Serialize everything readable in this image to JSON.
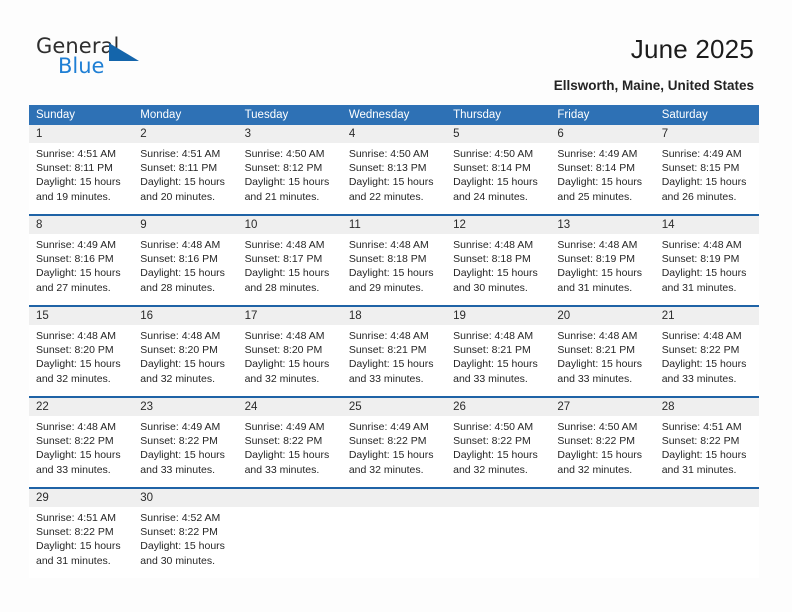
{
  "brand": {
    "name_part1": "General",
    "name_part2": "Blue",
    "accent_color": "#1f7fd4",
    "triangle_color": "#1465ab"
  },
  "header": {
    "title": "June 2025",
    "location": "Ellsworth, Maine, United States"
  },
  "theme": {
    "header_blue": "#2e71b5",
    "row_divider_blue": "#1f63a6",
    "daynum_band": "#efefef"
  },
  "weekdays": [
    "Sunday",
    "Monday",
    "Tuesday",
    "Wednesday",
    "Thursday",
    "Friday",
    "Saturday"
  ],
  "weeks": [
    [
      {
        "day": "1",
        "sunrise": "Sunrise: 4:51 AM",
        "sunset": "Sunset: 8:11 PM",
        "daylight1": "Daylight: 15 hours",
        "daylight2": "and 19 minutes."
      },
      {
        "day": "2",
        "sunrise": "Sunrise: 4:51 AM",
        "sunset": "Sunset: 8:11 PM",
        "daylight1": "Daylight: 15 hours",
        "daylight2": "and 20 minutes."
      },
      {
        "day": "3",
        "sunrise": "Sunrise: 4:50 AM",
        "sunset": "Sunset: 8:12 PM",
        "daylight1": "Daylight: 15 hours",
        "daylight2": "and 21 minutes."
      },
      {
        "day": "4",
        "sunrise": "Sunrise: 4:50 AM",
        "sunset": "Sunset: 8:13 PM",
        "daylight1": "Daylight: 15 hours",
        "daylight2": "and 22 minutes."
      },
      {
        "day": "5",
        "sunrise": "Sunrise: 4:50 AM",
        "sunset": "Sunset: 8:14 PM",
        "daylight1": "Daylight: 15 hours",
        "daylight2": "and 24 minutes."
      },
      {
        "day": "6",
        "sunrise": "Sunrise: 4:49 AM",
        "sunset": "Sunset: 8:14 PM",
        "daylight1": "Daylight: 15 hours",
        "daylight2": "and 25 minutes."
      },
      {
        "day": "7",
        "sunrise": "Sunrise: 4:49 AM",
        "sunset": "Sunset: 8:15 PM",
        "daylight1": "Daylight: 15 hours",
        "daylight2": "and 26 minutes."
      }
    ],
    [
      {
        "day": "8",
        "sunrise": "Sunrise: 4:49 AM",
        "sunset": "Sunset: 8:16 PM",
        "daylight1": "Daylight: 15 hours",
        "daylight2": "and 27 minutes."
      },
      {
        "day": "9",
        "sunrise": "Sunrise: 4:48 AM",
        "sunset": "Sunset: 8:16 PM",
        "daylight1": "Daylight: 15 hours",
        "daylight2": "and 28 minutes."
      },
      {
        "day": "10",
        "sunrise": "Sunrise: 4:48 AM",
        "sunset": "Sunset: 8:17 PM",
        "daylight1": "Daylight: 15 hours",
        "daylight2": "and 28 minutes."
      },
      {
        "day": "11",
        "sunrise": "Sunrise: 4:48 AM",
        "sunset": "Sunset: 8:18 PM",
        "daylight1": "Daylight: 15 hours",
        "daylight2": "and 29 minutes."
      },
      {
        "day": "12",
        "sunrise": "Sunrise: 4:48 AM",
        "sunset": "Sunset: 8:18 PM",
        "daylight1": "Daylight: 15 hours",
        "daylight2": "and 30 minutes."
      },
      {
        "day": "13",
        "sunrise": "Sunrise: 4:48 AM",
        "sunset": "Sunset: 8:19 PM",
        "daylight1": "Daylight: 15 hours",
        "daylight2": "and 31 minutes."
      },
      {
        "day": "14",
        "sunrise": "Sunrise: 4:48 AM",
        "sunset": "Sunset: 8:19 PM",
        "daylight1": "Daylight: 15 hours",
        "daylight2": "and 31 minutes."
      }
    ],
    [
      {
        "day": "15",
        "sunrise": "Sunrise: 4:48 AM",
        "sunset": "Sunset: 8:20 PM",
        "daylight1": "Daylight: 15 hours",
        "daylight2": "and 32 minutes."
      },
      {
        "day": "16",
        "sunrise": "Sunrise: 4:48 AM",
        "sunset": "Sunset: 8:20 PM",
        "daylight1": "Daylight: 15 hours",
        "daylight2": "and 32 minutes."
      },
      {
        "day": "17",
        "sunrise": "Sunrise: 4:48 AM",
        "sunset": "Sunset: 8:20 PM",
        "daylight1": "Daylight: 15 hours",
        "daylight2": "and 32 minutes."
      },
      {
        "day": "18",
        "sunrise": "Sunrise: 4:48 AM",
        "sunset": "Sunset: 8:21 PM",
        "daylight1": "Daylight: 15 hours",
        "daylight2": "and 33 minutes."
      },
      {
        "day": "19",
        "sunrise": "Sunrise: 4:48 AM",
        "sunset": "Sunset: 8:21 PM",
        "daylight1": "Daylight: 15 hours",
        "daylight2": "and 33 minutes."
      },
      {
        "day": "20",
        "sunrise": "Sunrise: 4:48 AM",
        "sunset": "Sunset: 8:21 PM",
        "daylight1": "Daylight: 15 hours",
        "daylight2": "and 33 minutes."
      },
      {
        "day": "21",
        "sunrise": "Sunrise: 4:48 AM",
        "sunset": "Sunset: 8:22 PM",
        "daylight1": "Daylight: 15 hours",
        "daylight2": "and 33 minutes."
      }
    ],
    [
      {
        "day": "22",
        "sunrise": "Sunrise: 4:48 AM",
        "sunset": "Sunset: 8:22 PM",
        "daylight1": "Daylight: 15 hours",
        "daylight2": "and 33 minutes."
      },
      {
        "day": "23",
        "sunrise": "Sunrise: 4:49 AM",
        "sunset": "Sunset: 8:22 PM",
        "daylight1": "Daylight: 15 hours",
        "daylight2": "and 33 minutes."
      },
      {
        "day": "24",
        "sunrise": "Sunrise: 4:49 AM",
        "sunset": "Sunset: 8:22 PM",
        "daylight1": "Daylight: 15 hours",
        "daylight2": "and 33 minutes."
      },
      {
        "day": "25",
        "sunrise": "Sunrise: 4:49 AM",
        "sunset": "Sunset: 8:22 PM",
        "daylight1": "Daylight: 15 hours",
        "daylight2": "and 32 minutes."
      },
      {
        "day": "26",
        "sunrise": "Sunrise: 4:50 AM",
        "sunset": "Sunset: 8:22 PM",
        "daylight1": "Daylight: 15 hours",
        "daylight2": "and 32 minutes."
      },
      {
        "day": "27",
        "sunrise": "Sunrise: 4:50 AM",
        "sunset": "Sunset: 8:22 PM",
        "daylight1": "Daylight: 15 hours",
        "daylight2": "and 32 minutes."
      },
      {
        "day": "28",
        "sunrise": "Sunrise: 4:51 AM",
        "sunset": "Sunset: 8:22 PM",
        "daylight1": "Daylight: 15 hours",
        "daylight2": "and 31 minutes."
      }
    ],
    [
      {
        "day": "29",
        "sunrise": "Sunrise: 4:51 AM",
        "sunset": "Sunset: 8:22 PM",
        "daylight1": "Daylight: 15 hours",
        "daylight2": "and 31 minutes."
      },
      {
        "day": "30",
        "sunrise": "Sunrise: 4:52 AM",
        "sunset": "Sunset: 8:22 PM",
        "daylight1": "Daylight: 15 hours",
        "daylight2": "and 30 minutes."
      },
      {
        "day": "",
        "sunrise": "",
        "sunset": "",
        "daylight1": "",
        "daylight2": ""
      },
      {
        "day": "",
        "sunrise": "",
        "sunset": "",
        "daylight1": "",
        "daylight2": ""
      },
      {
        "day": "",
        "sunrise": "",
        "sunset": "",
        "daylight1": "",
        "daylight2": ""
      },
      {
        "day": "",
        "sunrise": "",
        "sunset": "",
        "daylight1": "",
        "daylight2": ""
      },
      {
        "day": "",
        "sunrise": "",
        "sunset": "",
        "daylight1": "",
        "daylight2": ""
      }
    ]
  ]
}
